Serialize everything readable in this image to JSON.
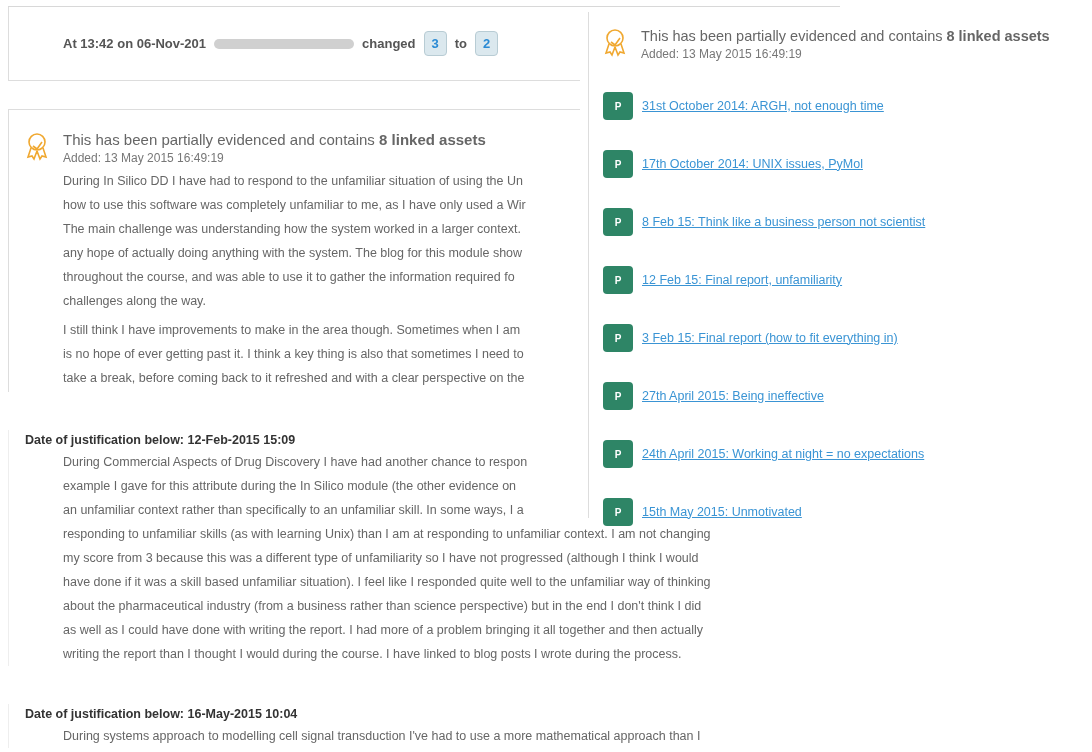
{
  "change_notice": {
    "prefix": "At 13:42 on 06-Nov-201",
    "verb": "changed",
    "from": "3",
    "connector": "to",
    "to": "2"
  },
  "evidence": {
    "title": "This has been partially evidenced and contains **8 linked assets**",
    "added": "Added: 13 May 2015 16:49:19",
    "paragraphs": [
      [
        "During In Silico DD I have had to respond to the unfamiliar situation of using the Un",
        "how to use this software was completely unfamiliar to me, as I have only used a Wir",
        "The main challenge was understanding how the system worked in a larger context.",
        "any hope of actually doing anything with the system. The blog for this module show",
        "throughout the course, and was able to use it to gather the information required fo",
        "challenges along the way."
      ],
      [
        "I still think I have improvements to make in the area though. Sometimes when I am",
        "is no hope of ever getting past it. I think a key thing is also that sometimes I need to",
        "take a break, before coming back to it refreshed and with a clear perspective on the"
      ]
    ]
  },
  "justifications": [
    {
      "heading": "Date of justification below: 12-Feb-2015 15:09",
      "lines": [
        "During Commercial Aspects of Drug Discovery I have had another chance to respon",
        "example I gave for this attribute during the In Silico module (the other evidence on",
        "an unfamiliar context rather than specifically to an unfamiliar skill. In some ways, I a",
        "responding to unfamiliar skills (as with learning Unix) than I am at responding to unfamiliar context. I am not changing",
        "my score from 3 because this was a different type of unfamiliarity so I have not progressed (although I think I would",
        "have done if it was a skill based unfamiliar situation). I feel like I responded quite well to the unfamiliar way of thinking",
        "about the pharmaceutical industry (from a business rather than science perspective) but in the end I don't think I did",
        "as well as I could have done with writing the report. I had more of a problem bringing it all together and then actually",
        "writing the report than I thought I would during the course. I have linked to blog posts I wrote during the process."
      ]
    },
    {
      "heading": "Date of justification below: 16-May-2015 10:04",
      "lines": [
        "During systems approach to modelling cell signal transduction I've had to use a more mathematical approach than I"
      ]
    }
  ],
  "assets_panel": {
    "title": "This has been partially evidenced and contains **8 linked assets**",
    "added": "Added: 13 May 2015 16:49:19",
    "assets": [
      {
        "badge": "P",
        "label": "31st October 2014: ARGH, not enough time"
      },
      {
        "badge": "P",
        "label": "17th October 2014: UNIX issues, PyMol"
      },
      {
        "badge": "P",
        "label": "8 Feb 15: Think like a business person not scientist"
      },
      {
        "badge": "P",
        "label": "12 Feb 15: Final report, unfamiliarity"
      },
      {
        "badge": "P",
        "label": "3 Feb 15: Final report (how to fit everything in)"
      },
      {
        "badge": "P",
        "label": "27th April 2015: Being ineffective"
      },
      {
        "badge": "P",
        "label": "24th April 2015: Working at night = no expectations"
      },
      {
        "badge": "P",
        "label": "15th May 2015: Unmotivated"
      }
    ]
  }
}
